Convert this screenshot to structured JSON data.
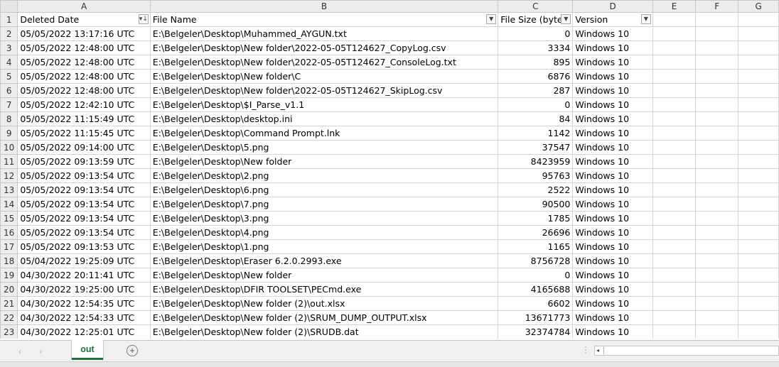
{
  "columns": [
    "A",
    "B",
    "C",
    "D",
    "E",
    "F",
    "G"
  ],
  "header_row": {
    "row_number": "1",
    "deleted_date": "Deleted Date",
    "file_name": "File Name",
    "file_size": "File Size (byte",
    "version": "Version"
  },
  "rows": [
    {
      "n": "2",
      "date": "05/05/2022 13:17:16 UTC",
      "name": "E:\\Belgeler\\Desktop\\Muhammed_AYGUN.txt",
      "size": "0",
      "ver": "Windows 10"
    },
    {
      "n": "3",
      "date": "05/05/2022 12:48:00 UTC",
      "name": "E:\\Belgeler\\Desktop\\New folder\\2022-05-05T124627_CopyLog.csv",
      "size": "3334",
      "ver": "Windows 10"
    },
    {
      "n": "4",
      "date": "05/05/2022 12:48:00 UTC",
      "name": "E:\\Belgeler\\Desktop\\New folder\\2022-05-05T124627_ConsoleLog.txt",
      "size": "895",
      "ver": "Windows 10"
    },
    {
      "n": "5",
      "date": "05/05/2022 12:48:00 UTC",
      "name": "E:\\Belgeler\\Desktop\\New folder\\C",
      "size": "6876",
      "ver": "Windows 10"
    },
    {
      "n": "6",
      "date": "05/05/2022 12:48:00 UTC",
      "name": "E:\\Belgeler\\Desktop\\New folder\\2022-05-05T124627_SkipLog.csv",
      "size": "287",
      "ver": "Windows 10"
    },
    {
      "n": "7",
      "date": "05/05/2022 12:42:10 UTC",
      "name": "E:\\Belgeler\\Desktop\\$I_Parse_v1.1",
      "size": "0",
      "ver": "Windows 10"
    },
    {
      "n": "8",
      "date": "05/05/2022 11:15:49 UTC",
      "name": "E:\\Belgeler\\Desktop\\desktop.ini",
      "size": "84",
      "ver": "Windows 10"
    },
    {
      "n": "9",
      "date": "05/05/2022 11:15:45 UTC",
      "name": "E:\\Belgeler\\Desktop\\Command Prompt.lnk",
      "size": "1142",
      "ver": "Windows 10"
    },
    {
      "n": "10",
      "date": "05/05/2022 09:14:00 UTC",
      "name": "E:\\Belgeler\\Desktop\\5.png",
      "size": "37547",
      "ver": "Windows 10"
    },
    {
      "n": "11",
      "date": "05/05/2022 09:13:59 UTC",
      "name": "E:\\Belgeler\\Desktop\\New folder",
      "size": "8423959",
      "ver": "Windows 10"
    },
    {
      "n": "12",
      "date": "05/05/2022 09:13:54 UTC",
      "name": "E:\\Belgeler\\Desktop\\2.png",
      "size": "95763",
      "ver": "Windows 10"
    },
    {
      "n": "13",
      "date": "05/05/2022 09:13:54 UTC",
      "name": "E:\\Belgeler\\Desktop\\6.png",
      "size": "2522",
      "ver": "Windows 10"
    },
    {
      "n": "14",
      "date": "05/05/2022 09:13:54 UTC",
      "name": "E:\\Belgeler\\Desktop\\7.png",
      "size": "90500",
      "ver": "Windows 10"
    },
    {
      "n": "15",
      "date": "05/05/2022 09:13:54 UTC",
      "name": "E:\\Belgeler\\Desktop\\3.png",
      "size": "1785",
      "ver": "Windows 10"
    },
    {
      "n": "16",
      "date": "05/05/2022 09:13:54 UTC",
      "name": "E:\\Belgeler\\Desktop\\4.png",
      "size": "26696",
      "ver": "Windows 10"
    },
    {
      "n": "17",
      "date": "05/05/2022 09:13:53 UTC",
      "name": "E:\\Belgeler\\Desktop\\1.png",
      "size": "1165",
      "ver": "Windows 10"
    },
    {
      "n": "18",
      "date": "05/04/2022 19:25:09 UTC",
      "name": "E:\\Belgeler\\Desktop\\Eraser 6.2.0.2993.exe",
      "size": "8756728",
      "ver": "Windows 10"
    },
    {
      "n": "19",
      "date": "04/30/2022 20:11:41 UTC",
      "name": "E:\\Belgeler\\Desktop\\New folder",
      "size": "0",
      "ver": "Windows 10"
    },
    {
      "n": "20",
      "date": "04/30/2022 19:25:00 UTC",
      "name": "E:\\Belgeler\\Desktop\\DFIR TOOLSET\\PECmd.exe",
      "size": "4165688",
      "ver": "Windows 10"
    },
    {
      "n": "21",
      "date": "04/30/2022 12:54:35 UTC",
      "name": "E:\\Belgeler\\Desktop\\New folder (2)\\out.xlsx",
      "size": "6602",
      "ver": "Windows 10"
    },
    {
      "n": "22",
      "date": "04/30/2022 12:54:33 UTC",
      "name": "E:\\Belgeler\\Desktop\\New folder (2)\\SRUM_DUMP_OUTPUT.xlsx",
      "size": "13671773",
      "ver": "Windows 10"
    },
    {
      "n": "23",
      "date": "04/30/2022 12:25:01 UTC",
      "name": "E:\\Belgeler\\Desktop\\New folder (2)\\SRUDB.dat",
      "size": "32374784",
      "ver": "Windows 10"
    }
  ],
  "sheet_tab": "out",
  "icons": {
    "sort_filter": "sort-descending-filter-icon",
    "filter": "filter-dropdown-icon",
    "add_sheet": "plus-circle-icon",
    "nav_prev": "chevron-left-icon",
    "nav_next": "chevron-right-icon"
  },
  "colors": {
    "accent": "#217346",
    "header_bg": "#ececec",
    "grid_line": "#d4d4d4"
  }
}
